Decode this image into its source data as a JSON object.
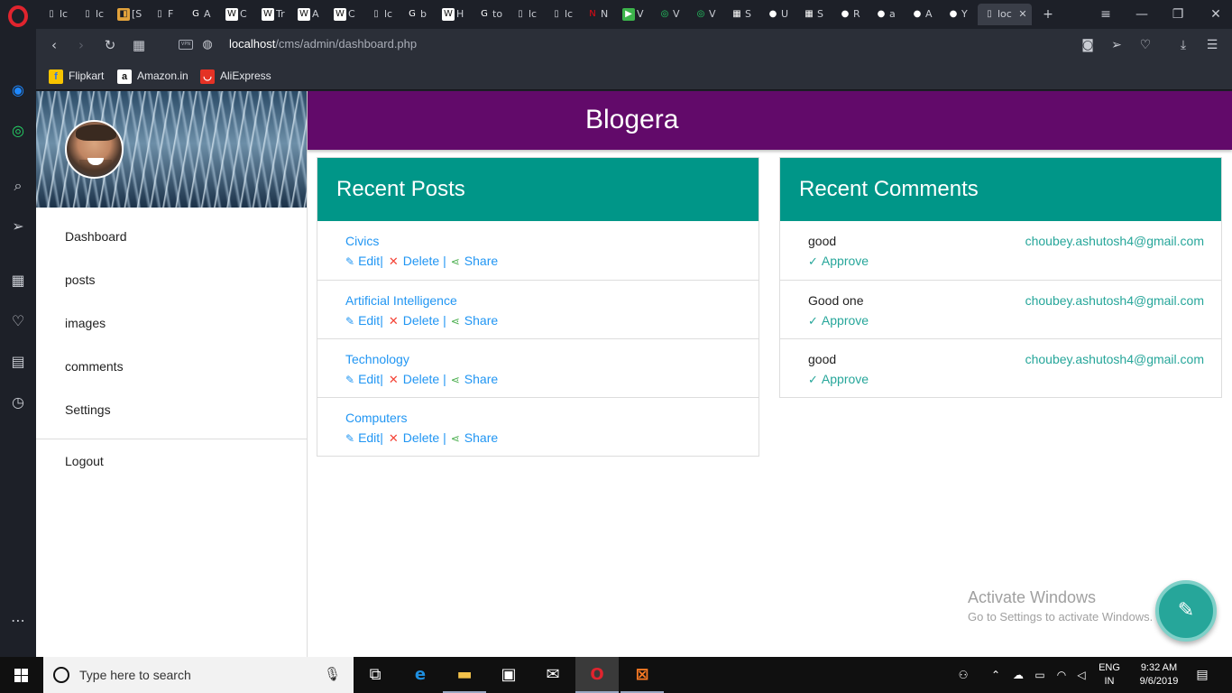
{
  "browser": {
    "tabs": [
      {
        "label": "lc",
        "icon": "page-icon"
      },
      {
        "label": "lc",
        "icon": "page-icon"
      },
      {
        "label": "[S",
        "icon": "image-icon"
      },
      {
        "label": "F",
        "icon": "page-icon"
      },
      {
        "label": "A",
        "icon": "google-icon"
      },
      {
        "label": "C",
        "icon": "wikipedia-icon"
      },
      {
        "label": "Tr",
        "icon": "wikipedia-icon"
      },
      {
        "label": "A",
        "icon": "wikipedia-icon"
      },
      {
        "label": "C",
        "icon": "wikipedia-icon"
      },
      {
        "label": "lc",
        "icon": "page-icon"
      },
      {
        "label": "b",
        "icon": "google-icon"
      },
      {
        "label": "H",
        "icon": "wikipedia-icon"
      },
      {
        "label": "to",
        "icon": "google-icon"
      },
      {
        "label": "lc",
        "icon": "page-icon"
      },
      {
        "label": "lc",
        "icon": "page-icon"
      },
      {
        "label": "N",
        "icon": "netflix-icon"
      },
      {
        "label": "V",
        "icon": "play-icon"
      },
      {
        "label": "V",
        "icon": "whatsapp-icon"
      },
      {
        "label": "V",
        "icon": "whatsapp-icon"
      },
      {
        "label": "S",
        "icon": "grid-icon"
      },
      {
        "label": "U",
        "icon": "github-icon"
      },
      {
        "label": "S",
        "icon": "grid-icon"
      },
      {
        "label": "R",
        "icon": "github-icon"
      },
      {
        "label": "a",
        "icon": "github-icon"
      },
      {
        "label": "A",
        "icon": "github-icon"
      },
      {
        "label": "Y",
        "icon": "github-icon"
      }
    ],
    "active_tab": {
      "label": "loc",
      "icon": "page-icon"
    },
    "url_host": "localhost",
    "url_path": "/cms/admin/dashboard.php",
    "vpn_label": "VPN",
    "bookmarks": [
      {
        "label": "Flipkart",
        "icon": "flipkart-icon",
        "color": "#f7c400"
      },
      {
        "label": "Amazon.in",
        "icon": "amazon-icon",
        "color": "#ffffff"
      },
      {
        "label": "AliExpress",
        "icon": "aliexpress-icon",
        "color": "#e43225"
      }
    ]
  },
  "app": {
    "brand": "Blogera",
    "header_color": "#620a6a",
    "accent_color": "#009688",
    "sidebar": {
      "items": [
        "Dashboard",
        "posts",
        "images",
        "comments",
        "Settings"
      ],
      "logout": "Logout"
    },
    "recent_posts": {
      "title": "Recent Posts",
      "edit_label": "Edit",
      "delete_label": "Delete",
      "share_label": "Share",
      "sep": "|",
      "items": [
        "Civics",
        "Artificial Intelligence",
        "Technology",
        "Computers"
      ]
    },
    "recent_comments": {
      "title": "Recent Comments",
      "approve_label": "Approve",
      "items": [
        {
          "text": "good",
          "email": "choubey.ashutosh4@gmail.com"
        },
        {
          "text": "Good one",
          "email": "choubey.ashutosh4@gmail.com"
        },
        {
          "text": "good",
          "email": "choubey.ashutosh4@gmail.com"
        }
      ]
    }
  },
  "watermark": {
    "line1": "Activate Windows",
    "line2": "Go to Settings to activate Windows."
  },
  "taskbar": {
    "search_placeholder": "Type here to search",
    "lang_line1": "ENG",
    "lang_line2": "IN",
    "time": "9:32 AM",
    "date": "9/6/2019"
  }
}
